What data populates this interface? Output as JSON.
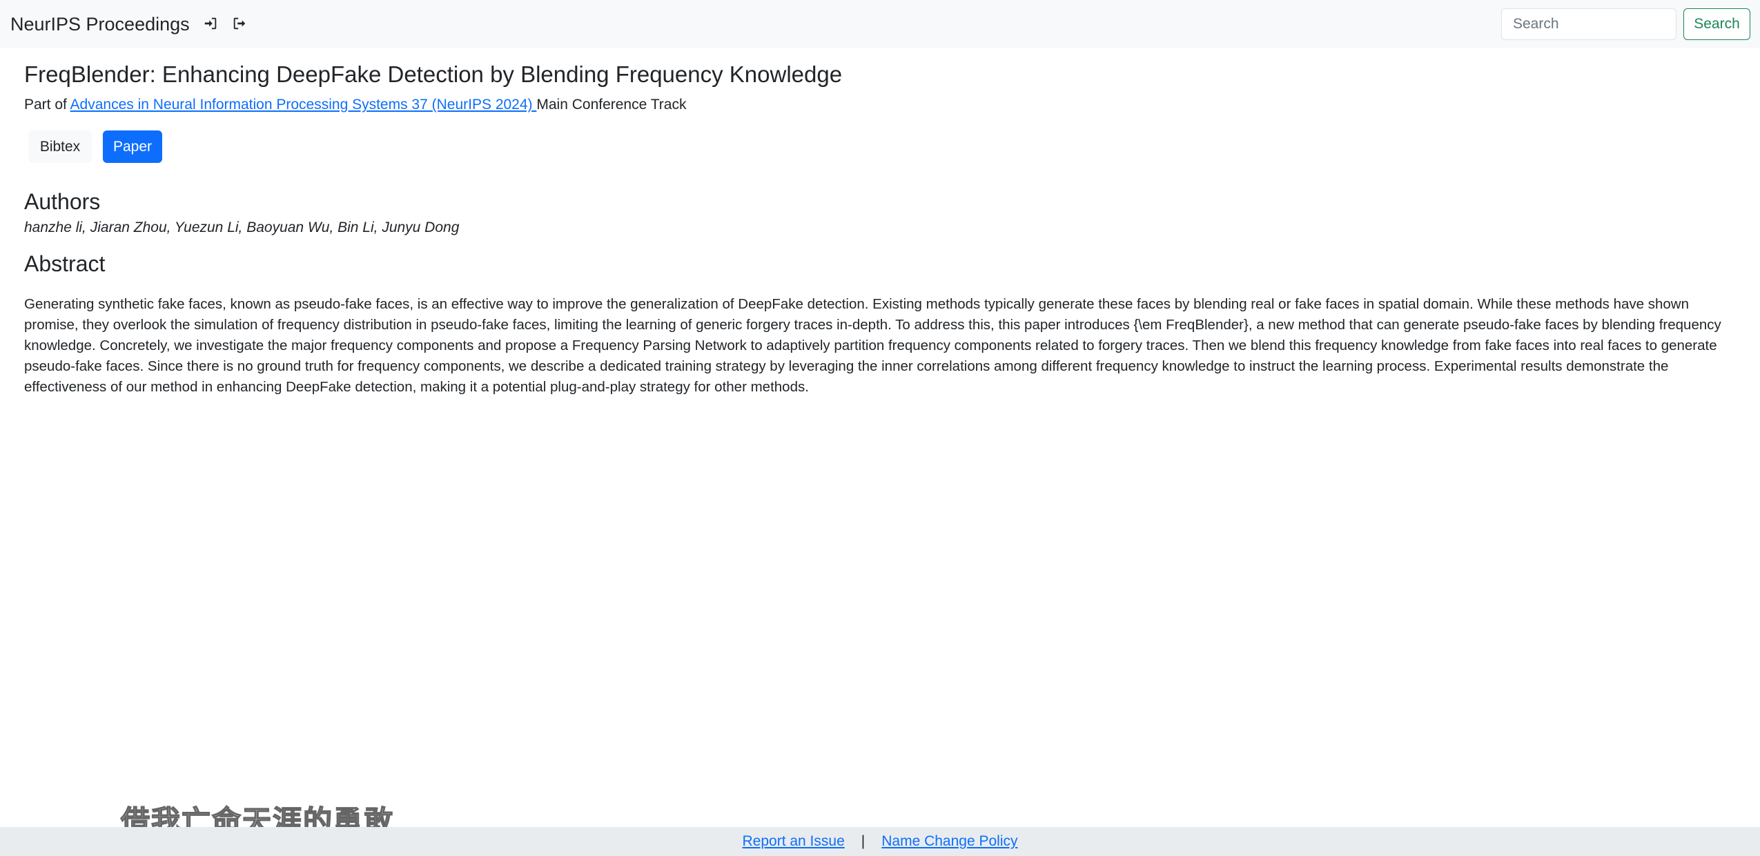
{
  "navbar": {
    "brand": "NeurIPS Proceedings",
    "icons": [
      "login-icon",
      "logout-icon"
    ],
    "search_placeholder": "Search",
    "search_button": "Search"
  },
  "paper": {
    "title": "FreqBlender: Enhancing DeepFake Detection by Blending Frequency Knowledge",
    "part_of_prefix": "Part of ",
    "conference_link": "Advances in Neural Information Processing Systems 37 (NeurIPS 2024) ",
    "track": "Main Conference Track",
    "buttons": {
      "bibtex": "Bibtex",
      "paper": "Paper"
    },
    "authors_heading": "Authors",
    "authors": "hanzhe li, Jiaran Zhou, Yuezun Li, Baoyuan Wu, Bin Li, Junyu Dong",
    "abstract_heading": "Abstract",
    "abstract": "Generating synthetic fake faces, known as pseudo-fake faces, is an effective way to improve the generalization of DeepFake detection. Existing methods typically generate these faces by blending real or fake faces in spatial domain. While these methods have shown promise, they overlook the simulation of frequency distribution in pseudo-fake faces, limiting the learning of generic forgery traces in-depth. To address this, this paper introduces {\\em FreqBlender}, a new method that can generate pseudo-fake faces by blending frequency knowledge. Concretely, we investigate the major frequency components and propose a Frequency Parsing Network to adaptively partition frequency components related to forgery traces. Then we blend this frequency knowledge from fake faces into real faces to generate pseudo-fake faces. Since there is no ground truth for frequency components, we describe a dedicated training strategy by leveraging the inner correlations among different frequency knowledge to instruct the learning process. Experimental results demonstrate the effectiveness of our method in enhancing DeepFake detection, making it a potential plug-and-play strategy for other methods."
  },
  "footer": {
    "report_issue": "Report an Issue",
    "separator": "|",
    "name_change_policy": "Name Change Policy"
  },
  "overlay": {
    "watermark_text": "借我亡命天涯的勇敢"
  },
  "colors": {
    "link": "#0d6efd",
    "primary_button": "#0d6efd",
    "search_button": "#198754",
    "navbar_bg": "#f8f9fa",
    "footer_bg": "#e9ecef"
  }
}
